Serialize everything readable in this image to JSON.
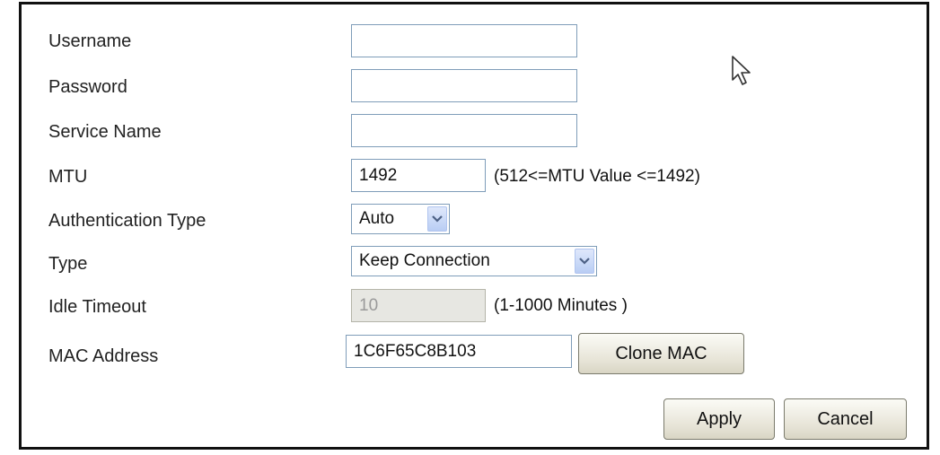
{
  "form": {
    "username": {
      "label": "Username",
      "value": ""
    },
    "password": {
      "label": "Password",
      "value": ""
    },
    "service_name": {
      "label": "Service Name",
      "value": ""
    },
    "mtu": {
      "label": "MTU",
      "value": "1492",
      "hint": "(512<=MTU Value <=1492)"
    },
    "auth_type": {
      "label": "Authentication Type",
      "selected": "Auto"
    },
    "type": {
      "label": "Type",
      "selected": "Keep Connection"
    },
    "idle_timeout": {
      "label": "Idle Timeout",
      "value": "10",
      "hint": "(1-1000 Minutes )"
    },
    "mac_address": {
      "label": "MAC Address",
      "value": "1C6F65C8B103",
      "clone_label": "Clone MAC"
    }
  },
  "actions": {
    "apply_label": "Apply",
    "cancel_label": "Cancel"
  },
  "icons": {
    "dropdown": "chevron-down-icon",
    "pointer": "mouse-pointer-icon"
  }
}
